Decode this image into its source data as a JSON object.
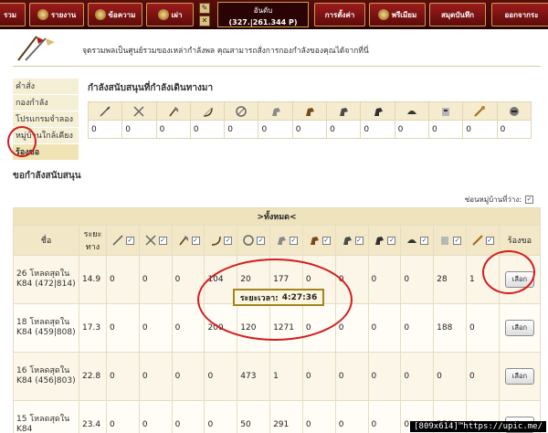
{
  "nav": {
    "items": [
      {
        "label": "รวม"
      },
      {
        "label": "รายงาน"
      },
      {
        "label": "ข้อความ"
      },
      {
        "label": "เผ่า"
      },
      {
        "label": "การตั้งค่า"
      },
      {
        "label": "พรีเมียม"
      },
      {
        "label": "สมุดบันทึก"
      },
      {
        "label": "ออกจากระ"
      }
    ],
    "clock_line1": "อันดับ",
    "clock_line2": "(327.|261.344 P)"
  },
  "intro_text": "จุดรวมพลเป็นศูนย์รวมของเหล่ากำลังพล คุณสามารถสั่งการกองกำลังของคุณได้จากที่นี่",
  "menu": {
    "items": [
      "คำสั่ง",
      "กองกำลัง",
      "โปรแกรมจำลอง",
      "หมู่บ้านใกล้เคียง",
      "ร้องขอ"
    ]
  },
  "support_section": {
    "title": "กำลังสนับสนุนที่กำลังเดินทางมา",
    "values": [
      "0",
      "0",
      "0",
      "0",
      "0",
      "0",
      "0",
      "0",
      "0",
      "0",
      "0",
      "0",
      "0"
    ]
  },
  "request_section": {
    "title": "ขอกำลังสนับสนุน",
    "only_free_label": "ซ่อนหมู่บ้านที่ว่าง:",
    "all_label": ">ทั้งหมด<",
    "col_name": "ชื่อ",
    "col_distance": "ระยะทาง",
    "col_request": "ร้องขอ",
    "button_label": "เลือก",
    "rows": [
      {
        "name": "26 โหลดสุดใน K84 (472|814)",
        "distance": "14.9",
        "units": [
          "0",
          "0",
          "0",
          "104",
          "20",
          "177",
          "0",
          "0",
          "0",
          "0",
          "28",
          "1"
        ]
      },
      {
        "name": "18 โหลดสุดใน K84 (459|808)",
        "distance": "17.3",
        "units": [
          "0",
          "0",
          "0",
          "200",
          "120",
          "1271",
          "0",
          "0",
          "0",
          "0",
          "188",
          "0"
        ]
      },
      {
        "name": "16 โหลดสุดใน K84 (456|803)",
        "distance": "22.8",
        "units": [
          "0",
          "0",
          "0",
          "0",
          "473",
          "1",
          "0",
          "0",
          "0",
          "0",
          "0",
          "0"
        ]
      },
      {
        "name": "15 โหลดสุดใน K84",
        "distance": "23.4",
        "units": [
          "0",
          "0",
          "0",
          "0",
          "50",
          "291",
          "0",
          "0",
          "0",
          "0",
          "250",
          "0"
        ]
      }
    ]
  },
  "travel_time": {
    "label": "ระยะเวลา:",
    "value": "4:27:36"
  },
  "watermark": "[809x614]™https://upic.me/",
  "colors": {
    "nav_bg": "#5a0c0c",
    "accent_gold": "#c9a14a",
    "highlight_red": "#d41c1c",
    "row_bg": "#fbf6e8"
  }
}
